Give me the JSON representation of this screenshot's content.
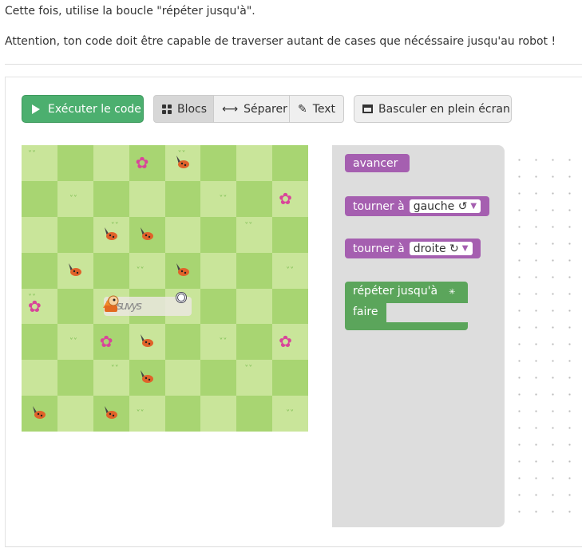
{
  "intro": {
    "line1": "Cette fois, utilise la boucle \"répéter jusqu'à\".",
    "line2": "Attention, ton code doit être capable de traverser autant de cases que nécéssaire jusqu'au robot !"
  },
  "toolbar": {
    "run_label": "Exécuter le code",
    "blocks_label": "Blocs",
    "split_label": "Séparer",
    "text_label": "Text",
    "fullscreen_label": "Basculer en plein écran"
  },
  "board": {
    "rows": 8,
    "cols": 8,
    "trail_text": "Vvsuvys",
    "items": [
      {
        "r": 0,
        "c": 3,
        "kind": "flower"
      },
      {
        "r": 0,
        "c": 4,
        "kind": "bug"
      },
      {
        "r": 1,
        "c": 7,
        "kind": "flower"
      },
      {
        "r": 2,
        "c": 2,
        "kind": "bug"
      },
      {
        "r": 2,
        "c": 3,
        "kind": "bug"
      },
      {
        "r": 3,
        "c": 1,
        "kind": "bug"
      },
      {
        "r": 3,
        "c": 4,
        "kind": "bug"
      },
      {
        "r": 4,
        "c": 0,
        "kind": "flower"
      },
      {
        "r": 5,
        "c": 2,
        "kind": "flower"
      },
      {
        "r": 5,
        "c": 3,
        "kind": "bug"
      },
      {
        "r": 5,
        "c": 7,
        "kind": "flower"
      },
      {
        "r": 6,
        "c": 3,
        "kind": "bug"
      },
      {
        "r": 7,
        "c": 0,
        "kind": "bug"
      },
      {
        "r": 7,
        "c": 2,
        "kind": "bug"
      }
    ]
  },
  "blocks": {
    "forward": "avancer",
    "turn_left_prefix": "tourner à",
    "turn_left_option": "gauche ↺",
    "turn_right_prefix": "tourner à",
    "turn_right_option": "droite ↻",
    "repeat_until": "répéter jusqu'à",
    "do": "faire"
  },
  "colors": {
    "run_button": "#4caf6f",
    "motion_block": "#a55fb0",
    "loop_block": "#5ba55b",
    "cell_light": "#c9e59a",
    "cell_dark": "#a8d572"
  },
  "icons": {
    "run": "play-icon",
    "blocks": "grid-icon",
    "split": "arrows-horizontal-icon",
    "text": "pencil-icon",
    "fullscreen": "window-icon",
    "target": "spiral-target-icon"
  }
}
